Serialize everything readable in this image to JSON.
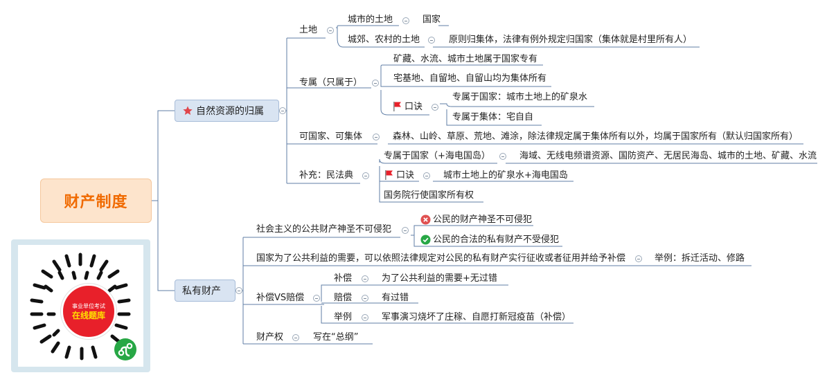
{
  "root": {
    "label": "财产制度"
  },
  "branch1": {
    "label": "自然资源的归属",
    "land": {
      "label": "土地",
      "city_label": "城市的土地",
      "city_value": "国家",
      "rural_label": "城郊、农村的土地",
      "rural_value": "原则归集体，法律有例外规定归国家（集体就是村里所有人）"
    },
    "exclusive": {
      "label": "专属（只属于）",
      "item1": "矿藏、水流、城市土地属于国家专有",
      "item2": "宅基地、自留地、自留山均为集体所有",
      "mnemonic_label": "口诀",
      "mnemonic_state": "专属于国家：城市土地上的矿泉水",
      "mnemonic_collective": "专属于集体：宅自自"
    },
    "either": {
      "label": "可国家、可集体",
      "value": "森林、山岭、草原、荒地、滩涂，除法律规定属于集体所有以外，均属于国家所有（默认归国家所有）"
    },
    "civil": {
      "label": "补充：民法典",
      "state_label": "专属于国家（+海电国岛）",
      "state_value": "海域、无线电频谱资源、国防资产、无居民海岛、城市的土地、矿藏、水流",
      "mnemonic_label": "口诀",
      "mnemonic_value": "城市土地上的矿泉水+海电国岛",
      "council": "国务院行使国家所有权"
    }
  },
  "branch2": {
    "label": "私有财产",
    "sacred": {
      "label": "社会主义的公共财产神圣不可侵犯",
      "wrong": "公民的财产神圣不可侵犯",
      "right": "公民的合法的私有财产不受侵犯"
    },
    "expropriation": {
      "label": "国家为了公共利益的需要，可以依照法律规定对公民的私有财产实行征收或者征用并给予补偿",
      "example": "举例：拆迁活动、修路"
    },
    "compensation": {
      "label": "补偿VS赔偿",
      "comp_label": "补偿",
      "comp_value": "为了公共利益的需要+无过错",
      "indem_label": "赔偿",
      "indem_value": "有过错",
      "ex_label": "举例",
      "ex_value": "军事演习烧坏了庄稼、自愿打新冠疫苗（补偿）"
    },
    "property_right": {
      "label": "财产权",
      "value": "写在“总纲”"
    }
  },
  "promo": {
    "line1": "事业单位考试",
    "line2": "在线题库"
  },
  "colors": {
    "root_bg": "#fde4cc",
    "root_text": "#f06a00",
    "main_bg": "#d9e4f2",
    "line": "#5f7ea6",
    "flag": "#e8202a",
    "wrong_icon": "#e05050",
    "right_icon": "#27a745"
  }
}
